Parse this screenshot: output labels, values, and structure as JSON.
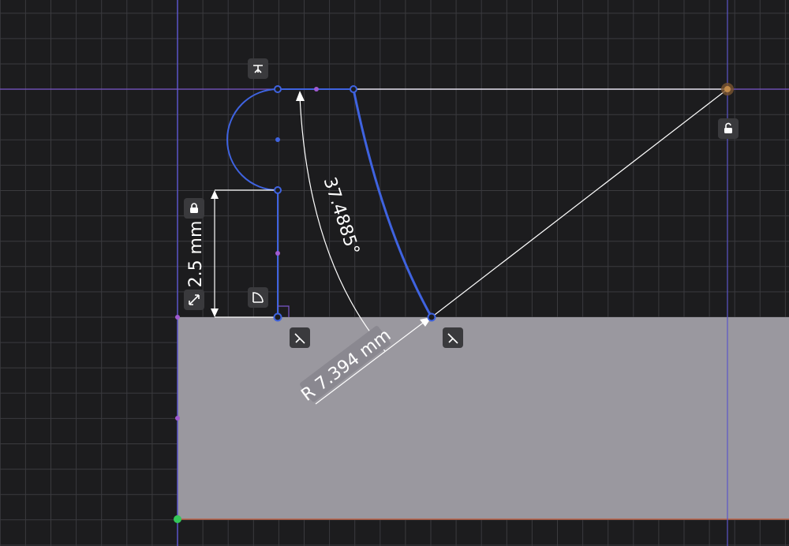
{
  "sketch": {
    "dimensions": {
      "height_label": "2.5 mm",
      "angle_label": "37.4885°",
      "radius_label": "R 7.394 mm"
    }
  },
  "constraint_chips": [
    {
      "icon": "horizontal-constraint-icon"
    },
    {
      "icon": "lock-icon"
    },
    {
      "icon": "fixed-size-icon"
    },
    {
      "icon": "tangent-constraint-icon"
    },
    {
      "icon": "coincident-constraint-icon"
    },
    {
      "icon": "coincident-constraint-icon"
    },
    {
      "icon": "unlock-icon"
    }
  ],
  "colors": {
    "background": "#1c1c1e",
    "grid_line": "#3a3a3e",
    "axis_line": "#5b55c9",
    "body_fill": "#9a989f",
    "sketch_line": "#3f63e0",
    "construction_line": "#ffffff",
    "origin_point": "#34c759",
    "pivot_point": "#c08a4a",
    "midpoint_marker": "#a05ad0"
  }
}
